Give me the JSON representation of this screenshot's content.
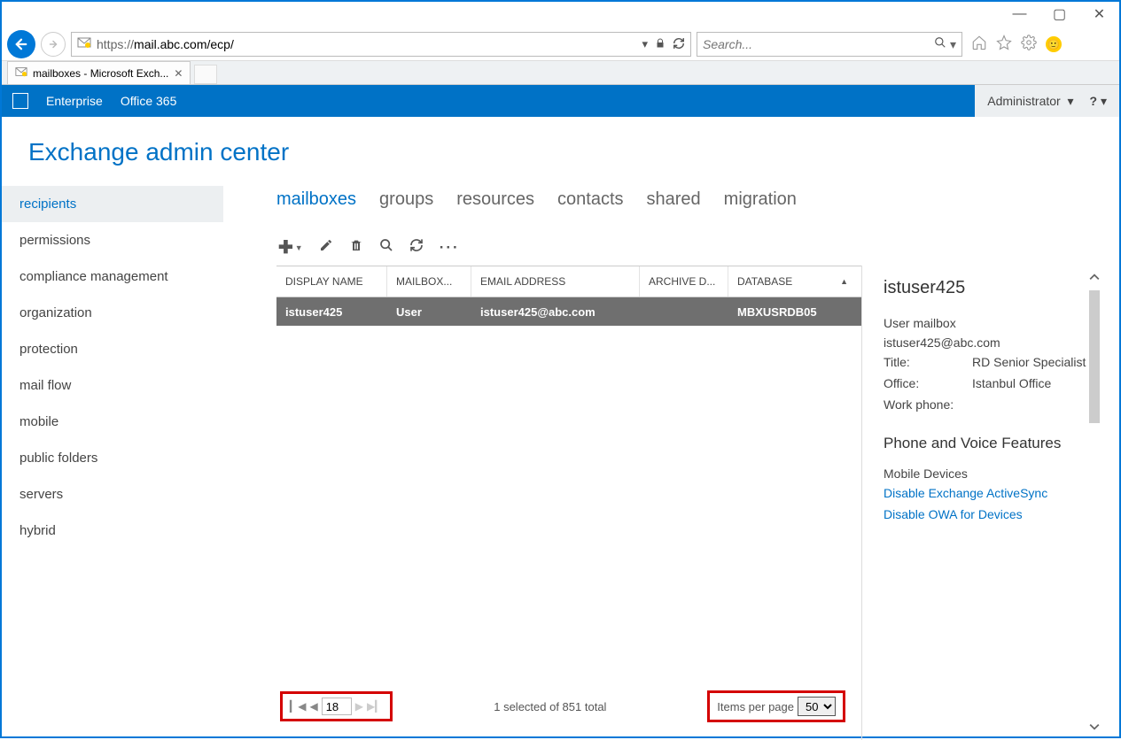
{
  "window": {
    "min": "—",
    "max": "▢",
    "close": "✕"
  },
  "browser": {
    "url_proto": "https://",
    "url_rest": "mail.abc.com/ecp/",
    "search_placeholder": "Search...",
    "tab_title": "mailboxes - Microsoft Exch..."
  },
  "o365": {
    "enterprise": "Enterprise",
    "office365": "Office 365",
    "admin": "Administrator",
    "help": "?"
  },
  "eac_title": "Exchange admin center",
  "sidebar": {
    "items": [
      {
        "label": "recipients",
        "active": true
      },
      {
        "label": "permissions"
      },
      {
        "label": "compliance management"
      },
      {
        "label": "organization"
      },
      {
        "label": "protection"
      },
      {
        "label": "mail flow"
      },
      {
        "label": "mobile"
      },
      {
        "label": "public folders"
      },
      {
        "label": "servers"
      },
      {
        "label": "hybrid"
      }
    ]
  },
  "subtabs": [
    {
      "label": "mailboxes",
      "active": true
    },
    {
      "label": "groups"
    },
    {
      "label": "resources"
    },
    {
      "label": "contacts"
    },
    {
      "label": "shared"
    },
    {
      "label": "migration"
    }
  ],
  "columns": {
    "display_name": "DISPLAY NAME",
    "mailbox_type": "MAILBOX...",
    "email": "EMAIL ADDRESS",
    "archive": "ARCHIVE D...",
    "database": "DATABASE"
  },
  "row": {
    "display_name": "istuser425",
    "mailbox_type": "User",
    "email": "istuser425@abc.com",
    "archive": "",
    "database": "MBXUSRDB05"
  },
  "details": {
    "name": "istuser425",
    "type": "User mailbox",
    "email": "istuser425@abc.com",
    "title_k": "Title:",
    "title_v": "RD Senior Specialist",
    "office_k": "Office:",
    "office_v": "Istanbul Office",
    "work_phone_k": "Work phone:",
    "section": "Phone and Voice Features",
    "mobile_devices": "Mobile Devices",
    "link1": "Disable Exchange ActiveSync",
    "link2": "Disable OWA for Devices"
  },
  "footer": {
    "page": "18",
    "status": "1 selected of 851 total",
    "ipp_label": "Items per page",
    "ipp_value": "50"
  }
}
